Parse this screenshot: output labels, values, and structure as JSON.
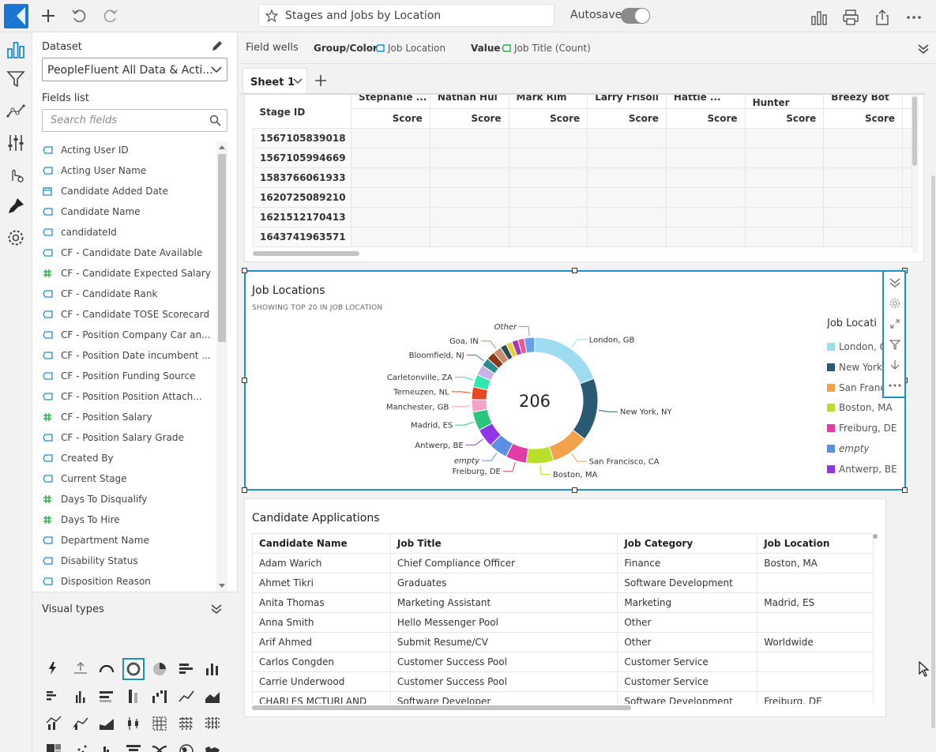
{
  "topbar": {
    "title": "Stages and Jobs by Location",
    "autosave_label": "Autosave"
  },
  "panel": {
    "dataset_label": "Dataset",
    "dataset_value": "PeopleFluent All Data & Acti...",
    "fields_list_label": "Fields list",
    "search_placeholder": "Search fields",
    "fields": [
      {
        "name": "Acting User ID",
        "type": "dimension"
      },
      {
        "name": "Acting User Name",
        "type": "dimension"
      },
      {
        "name": "Candidate Added Date",
        "type": "date"
      },
      {
        "name": "Candidate Name",
        "type": "dimension"
      },
      {
        "name": "candidateId",
        "type": "dimension"
      },
      {
        "name": "CF - Candidate Date Available",
        "type": "dimension"
      },
      {
        "name": "CF - Candidate Expected Salary",
        "type": "measure"
      },
      {
        "name": "CF - Candidate Rank",
        "type": "dimension"
      },
      {
        "name": "CF - Candidate TOSE Scorecard",
        "type": "dimension"
      },
      {
        "name": "CF - Position Company Car an...",
        "type": "dimension"
      },
      {
        "name": "CF - Position Date incumbent ...",
        "type": "dimension"
      },
      {
        "name": "CF - Position Funding Source",
        "type": "dimension"
      },
      {
        "name": "CF - Position Position Attach...",
        "type": "dimension"
      },
      {
        "name": "CF - Position Salary",
        "type": "measure"
      },
      {
        "name": "CF - Position Salary Grade",
        "type": "dimension"
      },
      {
        "name": "Created By",
        "type": "dimension"
      },
      {
        "name": "Current Stage",
        "type": "dimension"
      },
      {
        "name": "Days To Disqualify",
        "type": "measure"
      },
      {
        "name": "Days To Hire",
        "type": "measure"
      },
      {
        "name": "Department Name",
        "type": "dimension"
      },
      {
        "name": "Disability Status",
        "type": "dimension"
      },
      {
        "name": "Disposition Reason",
        "type": "dimension"
      }
    ],
    "visual_types_label": "Visual types"
  },
  "fieldwells": {
    "label": "Field wells",
    "group_label": "Group/Color",
    "group_value": "Job Location",
    "value_label": "Value",
    "value_value": "Job Title (Count)"
  },
  "sheet": {
    "tab_label": "Sheet 1"
  },
  "pivot": {
    "row_header": "Stage ID",
    "columns": [
      "Stephanie ...",
      "Nathan Hul",
      "Mark Rim",
      "Larry Frisoli",
      "Hattie ...",
      "Chuck Hunter",
      "Breezy Bot"
    ],
    "metric_label": "Score",
    "rows": [
      "1567105839018",
      "1567105994669",
      "1583766061933",
      "1620725089210",
      "1621512170413",
      "1643741963571"
    ]
  },
  "donut": {
    "title": "Job Locations",
    "subtitle": "SHOWING TOP 20 IN JOB LOCATION",
    "total": "206",
    "legend_title": "Job Locati",
    "legend": [
      {
        "label": "London, G",
        "color": "#9ddcf0"
      },
      {
        "label": "New York,",
        "color": "#2a5a73"
      },
      {
        "label": "San Franci",
        "color": "#f2a24b"
      },
      {
        "label": "Boston, MA",
        "color": "#b9de2b"
      },
      {
        "label": "Freiburg, DE",
        "color": "#e23ca8"
      },
      {
        "label": "empty",
        "color": "#5b8fe3"
      },
      {
        "label": "Antwerp, BE",
        "color": "#8e36e8"
      }
    ],
    "slices": [
      {
        "label": "London, GB",
        "value": 36,
        "color": "#9ddcf0"
      },
      {
        "label": "New York, NY",
        "value": 30,
        "color": "#2a5a73"
      },
      {
        "label": "San Francisco, CA",
        "value": 18,
        "color": "#f2a24b"
      },
      {
        "label": "Boston, MA",
        "value": 13,
        "color": "#b9de2b"
      },
      {
        "label": "Freiburg, DE",
        "value": 10,
        "color": "#e23ca8"
      },
      {
        "label": "empty",
        "value": 9,
        "color": "#5b8fe3"
      },
      {
        "label": "Antwerp, BE",
        "value": 9,
        "color": "#8e36e8"
      },
      {
        "label": "Madrid, ES",
        "value": 9,
        "color": "#2cc67a"
      },
      {
        "label": "Manchester, GB",
        "value": 6,
        "color": "#f4a2c8"
      },
      {
        "label": "Terneuzen, NL",
        "value": 6,
        "color": "#e8461e"
      },
      {
        "label": "Carletonville, ZA",
        "value": 6,
        "color": "#2ee8b0"
      },
      {
        "label": "",
        "value": 5,
        "color": "#c9b3e8"
      },
      {
        "label": "Bloomfield, NJ",
        "value": 4,
        "color": "#2a8c8c"
      },
      {
        "label": "",
        "value": 4,
        "color": "#8b3a1a"
      },
      {
        "label": "Goa, IN",
        "value": 4,
        "color": "#c98b6a"
      },
      {
        "label": "",
        "value": 3,
        "color": "#2b4a5a"
      },
      {
        "label": "",
        "value": 3,
        "color": "#e8d23a"
      },
      {
        "label": "",
        "value": 3,
        "color": "#a03ab8"
      },
      {
        "label": "",
        "value": 3,
        "color": "#e85a9a"
      },
      {
        "label": "Other",
        "value": 5,
        "color": "#6aa0e8"
      }
    ]
  },
  "apps": {
    "title": "Candidate Applications",
    "headers": [
      "Candidate Name",
      "Job Title",
      "Job Category",
      "Job Location"
    ],
    "rows": [
      [
        "Adam Warich",
        "Chief Compliance Officer",
        "Finance",
        "Boston, MA"
      ],
      [
        "Ahmet Tikri",
        "Graduates",
        "Software Development",
        ""
      ],
      [
        "Anita Thomas",
        "Marketing Assistant",
        "Marketing",
        "Madrid, ES"
      ],
      [
        "Anna Smith",
        "Hello Messenger Pool",
        "Other",
        ""
      ],
      [
        "Arif Ahmed",
        "Submit Resume/CV",
        "Other",
        "Worldwide"
      ],
      [
        "Carlos Congden",
        "Customer Success Pool",
        "Customer Service",
        ""
      ],
      [
        "Carrie Underwood",
        "Customer Success Pool",
        "Customer Service",
        ""
      ],
      [
        "CHARLES MCTURLAND",
        "Software Developer",
        "Software Development",
        "Freiburg, DE"
      ]
    ]
  }
}
